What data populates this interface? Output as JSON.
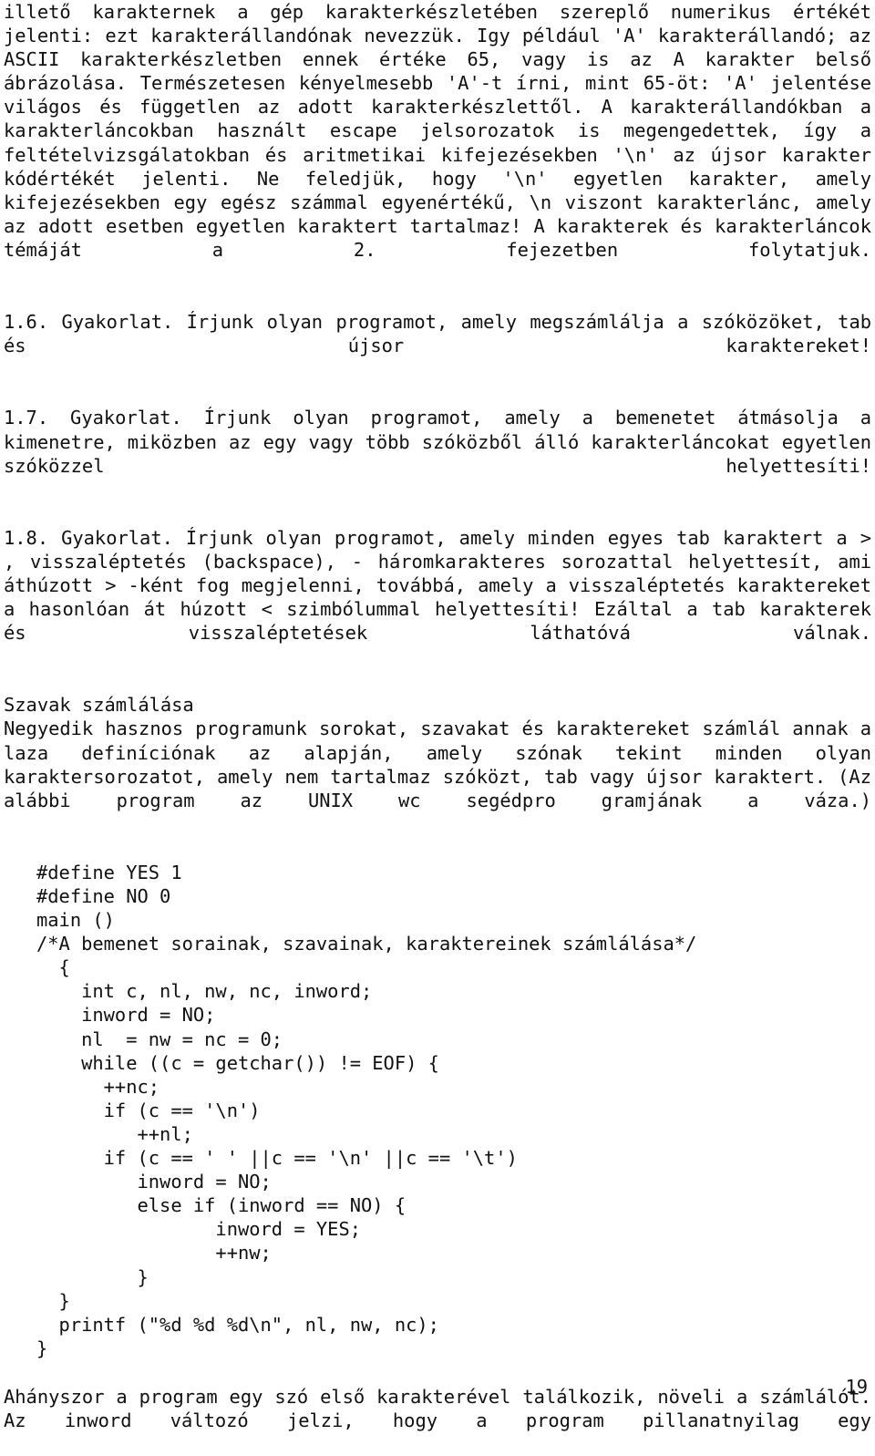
{
  "document": {
    "language": "hu",
    "page_number": "19",
    "text_color": "#111111",
    "background_color": "#ffffff"
  },
  "content": {
    "paragraph_continued": "illető karakternek a gép karakterkészletében szereplő numerikus értékét jelenti: ezt karakterállandónak nevezzük. Igy például 'A' karakterállandó; az ASCII karakterkészletben ennek értéke 65, vagy is az A karakter belső ábrázolása. Természetesen kényelmesebb 'A'-t írni, mint 65-öt: 'A' jelentése világos és független az adott karakterkészlettől. A karakterállandókban a karakterláncokban használt escape jelsorozatok is megengedettek, így a feltételvizsgálatokban és aritmetikai kifejezésekben '\\n' az újsor karakter kódértékét jelenti. Ne feledjük, hogy '\\n' egyetlen karakter, amely kifejezésekben egy egész számmal egyenértékű, \\n viszont karakterlánc, amely az adott esetben egyetlen karaktert tartalmaz! A karakterek és karakterláncok témáját a 2. fejezetben folytatjuk.",
    "exercise_1_6": "1.6. Gyakorlat. Írjunk olyan programot, amely megszámlálja a szóközöket, tab és újsor karaktereket!",
    "exercise_1_7": "1.7. Gyakorlat. Írjunk olyan programot, amely a bemenetet átmásolja a kimenetre, miközben az egy vagy több szóközből álló karakterláncokat egyetlen szóközzel helyettesíti!",
    "exercise_1_8": "1.8. Gyakorlat. Írjunk olyan programot, amely minden egyes tab karaktert a > , visszaléptetés (backspace), - háromkarakteres sorozattal helyettesít, ami áthúzott > -ként fog megjelenni, továbbá, amely a visszaléptetés karaktereket a hasonlóan át húzott < szimbólummal helyettesíti! Ezáltal a tab karakterek és visszaléptetések láthatóvá válnak.",
    "section_heading": "Szavak számlálása",
    "section_paragraph": "Negyedik hasznos programunk sorokat, szavakat és karaktereket számlál annak a laza definíciónak az alapján, amely szónak tekint minden olyan karaktersorozatot, amely nem tartalmaz szóközt, tab vagy újsor karaktert. (Az alábbi program az UNIX wc segédpro gramjának a váza.)",
    "code_listing": "#define YES 1\n#define NO 0\nmain ()\n/*A bemenet sorainak, szavainak, karaktereinek számlálása*/\n  {\n    int c, nl, nw, nc, inword;\n    inword = NO;\n    nl  = nw = nc = 0;\n    while ((c = getchar()) != EOF) {\n      ++nc;\n      if (c == '\\n')\n         ++nl;\n      if (c == ' ' ||c == '\\n' ||c == '\\t')\n         inword = NO;\n         else if (inword == NO) {\n                inword = YES;\n                ++nw;\n         }\n  }\n  printf (\"%d %d %d\\n\", nl, nw, nc);\n}",
    "closing_paragraph": "Ahányszor a program egy szó első karakterével találkozik, növeli a számlálót. Az inword változó jelzi, hogy a program pillanatnyilag egy"
  }
}
